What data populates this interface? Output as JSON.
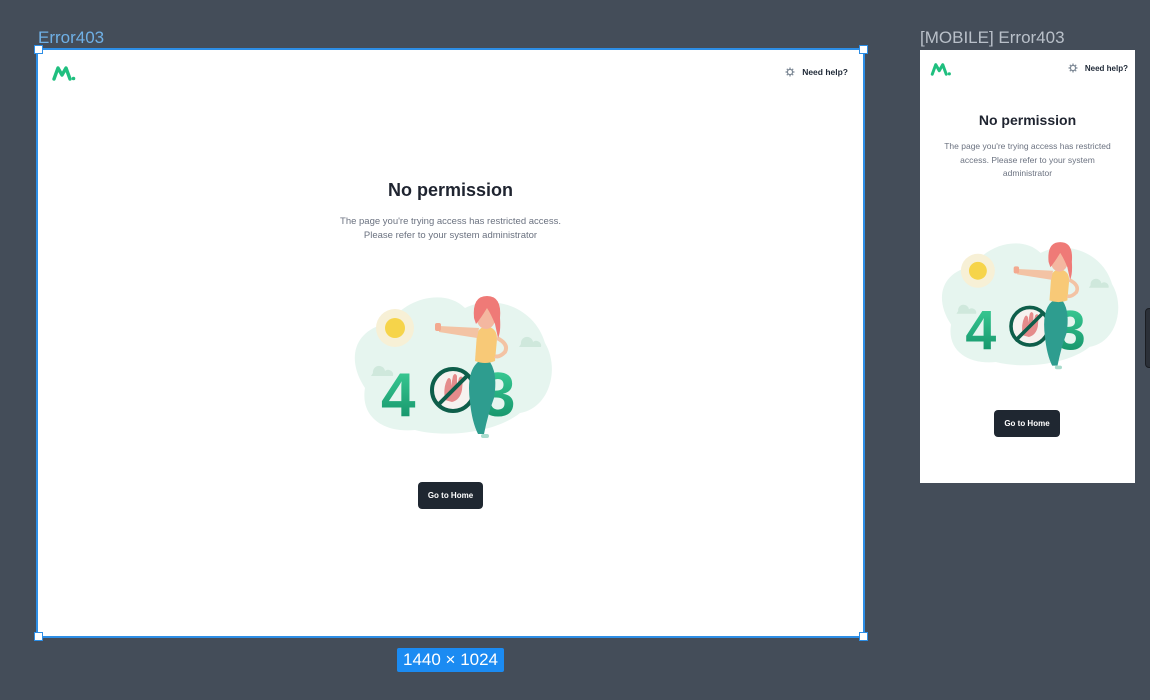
{
  "canvas": {
    "desktop_frame_label": "Error403",
    "mobile_frame_label": "[MOBILE] Error403",
    "size_badge": "1440 × 1024",
    "selection_color": "#2d8ee6",
    "background_color": "#444d59"
  },
  "page": {
    "help_label": "Need help?",
    "help_icon": "gear-icon",
    "logo_icon": "brand-logo-icon",
    "brand_color": "#1fbf7f",
    "title": "No permission",
    "subtitle_line1": "The page you're trying access has restricted access.",
    "subtitle_line2": "Please refer to your system administrator",
    "mobile_subtitle_line1": "The page you're trying access has restricted",
    "mobile_subtitle_line2": "access. Please refer to your system",
    "mobile_subtitle_line3": "administrator",
    "illustration_text": "403",
    "home_button_label": "Go to Home",
    "button_color": "#1f2731"
  }
}
